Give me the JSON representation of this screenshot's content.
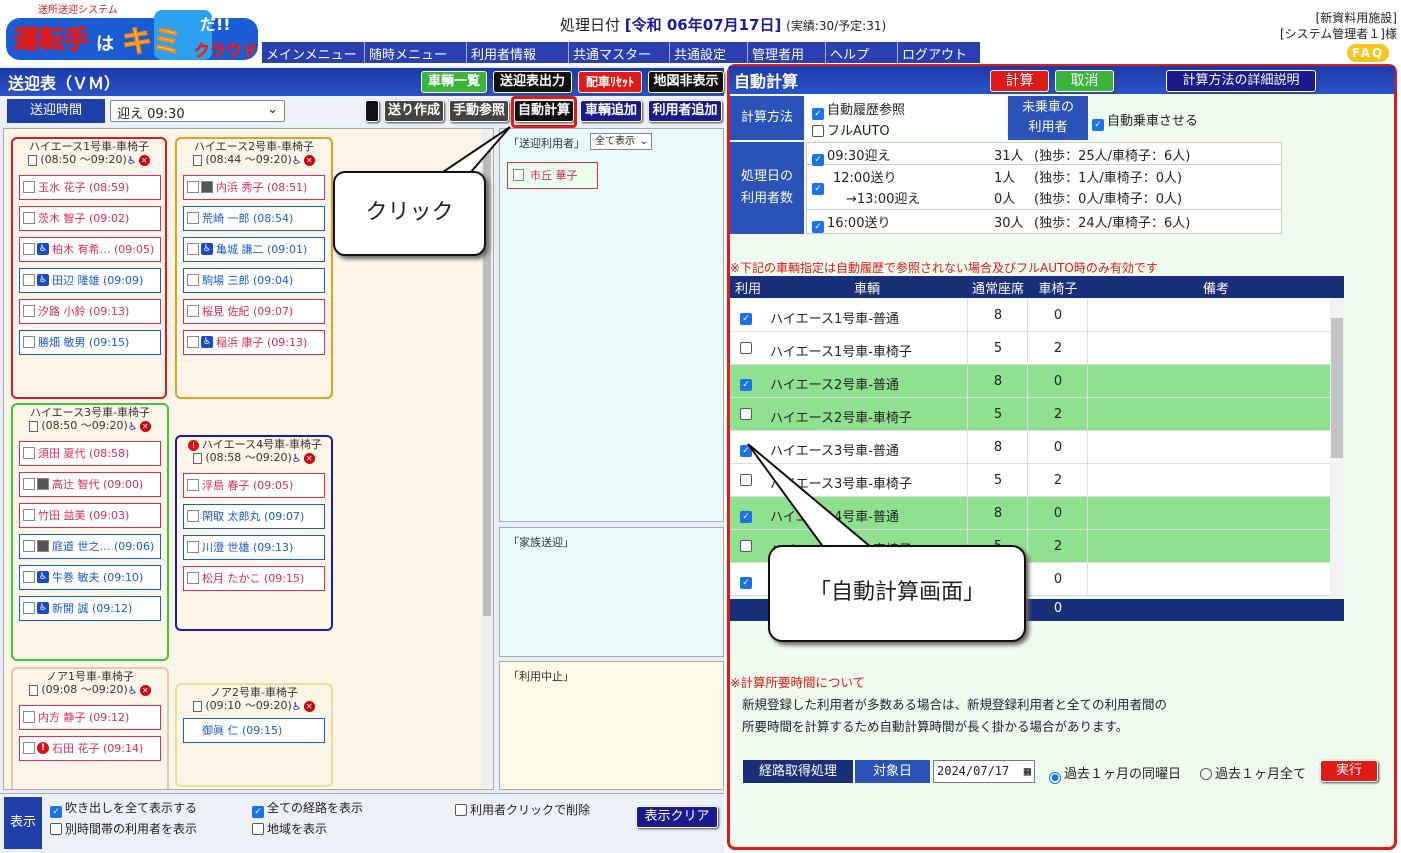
{
  "header": {
    "logo_small": "送所送迎システム",
    "logo_main_1": "運転手",
    "logo_main_2": "は",
    "logo_main_3": "キミ",
    "logo_main_4": "だ!!",
    "logo_cloud": "クラウド",
    "date_prefix": "処理日付",
    "date_value": "[令和 06年07月17日]",
    "date_stats": "(実績:30/予定:31)",
    "facility": "[新資料用施設]",
    "user": "[システム管理者１]様",
    "faq": "FAQ"
  },
  "menu": [
    "メインメニュー",
    "随時メニュー",
    "利用者情報",
    "共通マスター",
    "共通設定",
    "管理者用",
    "ヘルプ",
    "ログアウト"
  ],
  "left": {
    "title": "送迎表（ＶＭ）",
    "buttons_row1": [
      "車輌一覧",
      "送迎表出力",
      "配車ﾘｾｯﾄ",
      "地図非表示"
    ],
    "buttons_row2": [
      "送り作成",
      "手動参照",
      "自動計算",
      "車輌追加",
      "利用者追加"
    ],
    "time_label": "送迎時間",
    "time_value": "迎え 09:30",
    "vehicles": [
      {
        "name": "ハイエース1号車-車椅子",
        "time": "(08:50 ～09:20)",
        "color": "#e01919",
        "alert": false,
        "passengers": [
          [
            "玉水 花子 (08:59)",
            "r"
          ],
          [
            "茨木 智子 (09:02)",
            "r"
          ],
          [
            "柏木 有希… (09:05)",
            "r"
          ],
          [
            "田辺 隆雄 (09:09)",
            "b"
          ],
          [
            "汐路 小鈴 (09:13)",
            "r"
          ],
          [
            "勝畑 敏男 (09:15)",
            "b"
          ]
        ]
      },
      {
        "name": "ハイエース2号車-車椅子",
        "time": "(08:44 ～09:20)",
        "color": "#e0a020",
        "alert": false,
        "passengers": [
          [
            "内浜 秀子 (08:51)",
            "r"
          ],
          [
            "荒崎 一郎 (08:54)",
            "b"
          ],
          [
            "亀城 謙二 (09:01)",
            "b"
          ],
          [
            "駒場 三郎 (09:04)",
            "b"
          ],
          [
            "桜見 佐紀 (09:07)",
            "r"
          ],
          [
            "稲浜 康子 (09:13)",
            "r"
          ]
        ]
      },
      {
        "name": "ハイエース3号車-車椅子",
        "time": "(08:50 ～09:20)",
        "color": "#3cc83c",
        "alert": false,
        "passengers": [
          [
            "須田 夏代 (08:58)",
            "r"
          ],
          [
            "高辻 智代 (09:00)",
            "r"
          ],
          [
            "竹田 益美 (09:03)",
            "r"
          ],
          [
            "庭道 世之… (09:06)",
            "b"
          ],
          [
            "牛巻 敏夫 (09:10)",
            "b"
          ],
          [
            "新開 誠 (09:12)",
            "b"
          ]
        ]
      },
      {
        "name": "ハイエース4号車-車椅子",
        "time": "(08:58 ～09:20)",
        "color": "#1a1ab4",
        "alert": true,
        "passengers": [
          [
            "浮島 春子 (09:05)",
            "r"
          ],
          [
            "閑取 太郎丸 (09:07)",
            "b"
          ],
          [
            "川澄 世雄 (09:13)",
            "b"
          ],
          [
            "松月 たかこ (09:15)",
            "r"
          ]
        ]
      },
      {
        "name": "ノア1号車-車椅子",
        "time": "(09:08 ～09:20)",
        "color": "#e8c8a8",
        "alert": false,
        "passengers": [
          [
            "内方 静子 (09:12)",
            "r"
          ],
          [
            "石田 花子 (09:14)",
            "r"
          ]
        ]
      },
      {
        "name": "ノア2号車-車椅子",
        "time": "(09:10 ～09:20)",
        "color": "#f0dc90",
        "alert": false,
        "passengers": [
          [
            "御眞 仁 (09:15)",
            "b"
          ]
        ]
      }
    ],
    "side": {
      "box1_label": "「送迎利用者」",
      "box1_select": "全て表示",
      "box1_person": "市丘 華子",
      "box2_label": "「家族送迎」",
      "box3_label": "「利用中止」"
    },
    "bottom": {
      "label": "表示",
      "opt1": "吹き出しを全て表示する",
      "opt2": "別時間帯の利用者を表示",
      "opt3": "全ての経路を表示",
      "opt4": "地域を表示",
      "opt5": "利用者クリックで削除",
      "clear_btn": "表示クリア"
    }
  },
  "right": {
    "title": "自動計算",
    "btn_calc": "計算",
    "btn_cancel": "取消",
    "btn_explain": "計算方法の詳細説明",
    "method_label": "計算方法",
    "method_opt1": "自動履歴参照",
    "method_opt2": "フルAUTO",
    "unboarded_label_1": "未乗車の",
    "unboarded_label_2": "利用者",
    "unboarded_opt": "自動乗車させる",
    "count_label_1": "処理日の",
    "count_label_2": "利用者数",
    "counts": [
      {
        "time": "09:30迎え",
        "n": "31人",
        "detail": "(独歩：25人/車椅子：6人)"
      },
      {
        "time": "12:00送り",
        "n": "1人",
        "detail": "(独歩：1人/車椅子：0人)"
      },
      {
        "time": "→13:00迎え",
        "n": "0人",
        "detail": "(独歩：0人/車椅子：0人)"
      },
      {
        "time": "16:00送り",
        "n": "30人",
        "detail": "(独歩：24人/車椅子：6人)"
      }
    ],
    "note1": "※下記の車輌指定は自動履歴で参照されない場合及びフルAUTO時のみ有効です",
    "table_head": [
      "利用",
      "車輌",
      "通常座席",
      "車椅子",
      "備考"
    ],
    "table_rows": [
      {
        "checked": true,
        "name": "ハイエース1号車-普通",
        "seat": "8",
        "wc": "0",
        "green": false
      },
      {
        "checked": false,
        "name": "ハイエース1号車-車椅子",
        "seat": "5",
        "wc": "2",
        "green": false
      },
      {
        "checked": true,
        "name": "ハイエース2号車-普通",
        "seat": "8",
        "wc": "0",
        "green": true
      },
      {
        "checked": false,
        "name": "ハイエース2号車-車椅子",
        "seat": "5",
        "wc": "2",
        "green": true
      },
      {
        "checked": true,
        "name": "ハイエース3号車-普通",
        "seat": "8",
        "wc": "0",
        "green": false
      },
      {
        "checked": false,
        "name": "ハイエース3号車-車椅子",
        "seat": "5",
        "wc": "2",
        "green": false
      },
      {
        "checked": true,
        "name": "ハイエース4号車-普通",
        "seat": "8",
        "wc": "0",
        "green": true
      },
      {
        "checked": false,
        "name": "ハイエース4号車-車椅子",
        "seat": "5",
        "wc": "2",
        "green": true
      },
      {
        "checked": true,
        "name": "",
        "seat": "",
        "wc": "0",
        "green": false
      }
    ],
    "table_total": "0",
    "note2_title": "※計算所要時間について",
    "note2_line1": "新規登録した利用者が多数ある場合は、新規登録利用者と全ての利用者間の",
    "note2_line2": "所要時間を計算するため自動計算時間が長く掛かる場合があります。",
    "route_label": "経路取得処理",
    "target_label": "対象日",
    "target_date": "2024/07/17",
    "radio1": "過去１ヶ月の同曜日",
    "radio2": "過去１ヶ月全て",
    "exec_btn": "実行"
  },
  "callouts": {
    "click": "クリック",
    "screen": "「自動計算画面」"
  }
}
